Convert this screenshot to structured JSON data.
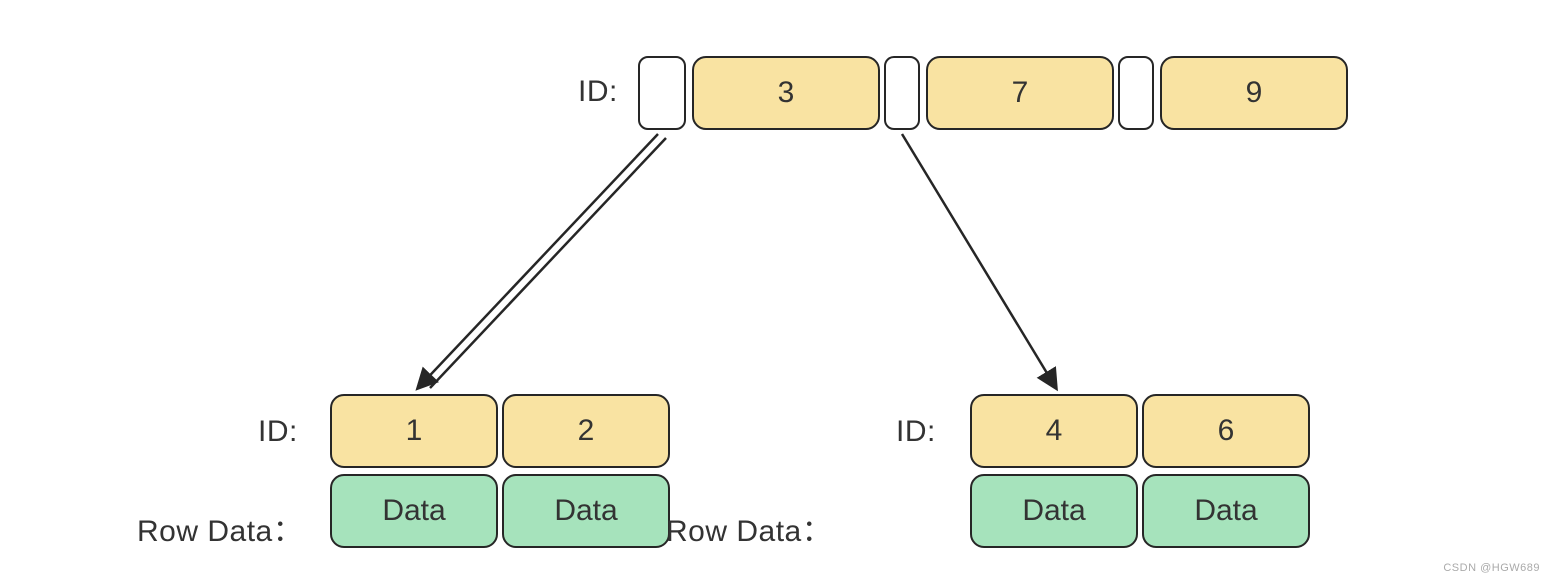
{
  "labels": {
    "root_id": "ID:",
    "leaf1_id": "ID:",
    "leaf1_row": "Row Data：",
    "leaf2_id": "ID:",
    "leaf2_row": "Row Data："
  },
  "root": {
    "slots": [
      "",
      "3",
      "",
      "7",
      "",
      "9"
    ]
  },
  "leaves": [
    {
      "ids": [
        "1",
        "2"
      ],
      "data": [
        "Data",
        "Data"
      ]
    },
    {
      "ids": [
        "4",
        "6"
      ],
      "data": [
        "Data",
        "Data"
      ]
    }
  ],
  "watermark": "CSDN @HGW689",
  "colors": {
    "id_cell": "#f9e3a2",
    "data_cell": "#a6e3bc",
    "pointer_cell": "#ffffff",
    "border": "#262626"
  }
}
